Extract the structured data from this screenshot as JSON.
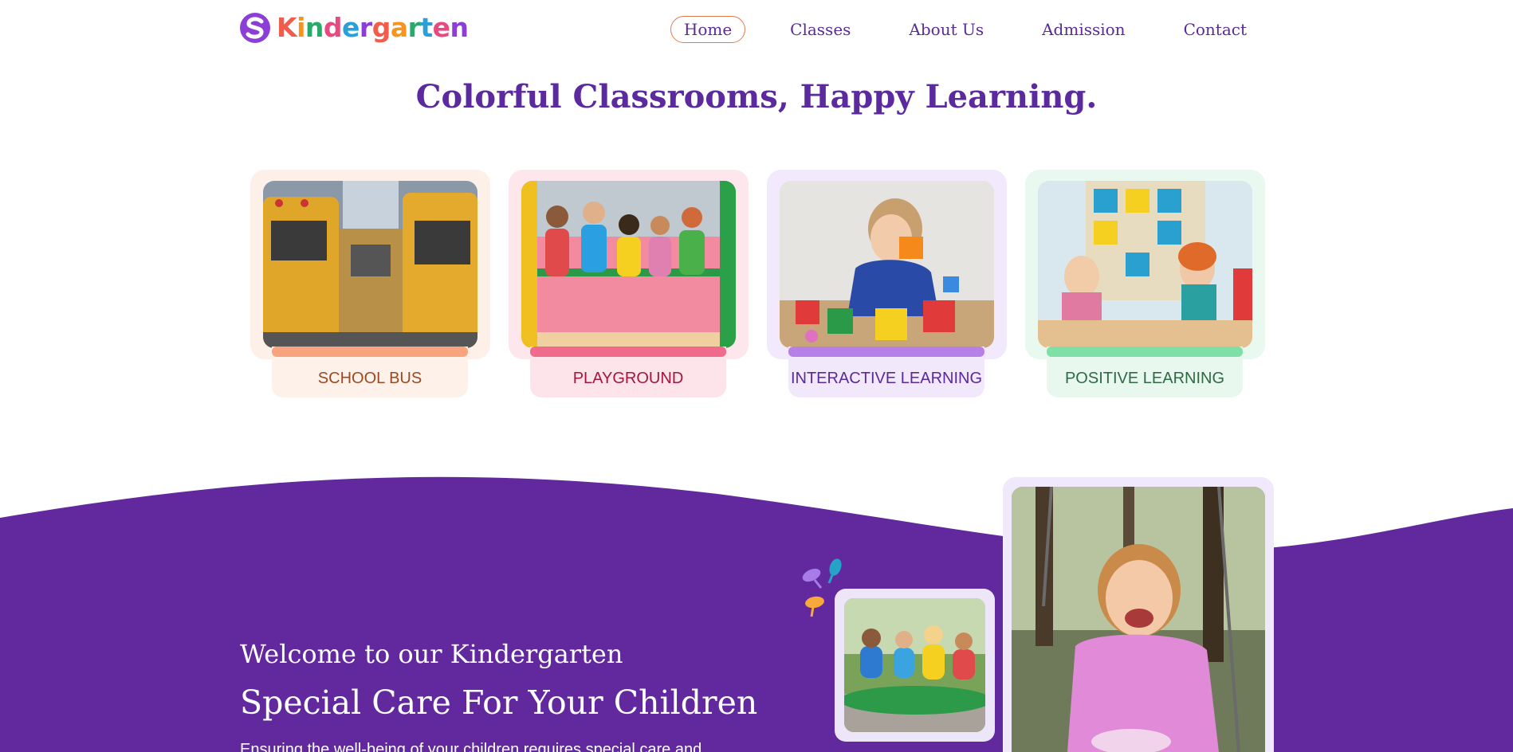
{
  "brand": {
    "name": "Kindergarten",
    "letters": [
      {
        "ch": "K",
        "color": "#f25c4c"
      },
      {
        "ch": "i",
        "color": "#f7941d"
      },
      {
        "ch": "n",
        "color": "#2aaa6a"
      },
      {
        "ch": "d",
        "color": "#e84a7f"
      },
      {
        "ch": "e",
        "color": "#2a9fd8"
      },
      {
        "ch": "r",
        "color": "#8b3fd6"
      },
      {
        "ch": "g",
        "color": "#f25c4c"
      },
      {
        "ch": "a",
        "color": "#f7941d"
      },
      {
        "ch": "r",
        "color": "#2aaa6a"
      },
      {
        "ch": "t",
        "color": "#2a9fd8"
      },
      {
        "ch": "e",
        "color": "#e84a7f"
      },
      {
        "ch": "n",
        "color": "#8b3fd6"
      }
    ],
    "logo_icon": "s-swirl-icon"
  },
  "nav": {
    "items": [
      {
        "label": "Home",
        "active": true
      },
      {
        "label": "Classes",
        "active": false
      },
      {
        "label": "About Us",
        "active": false
      },
      {
        "label": "Admission",
        "active": false
      },
      {
        "label": "Contact",
        "active": false
      }
    ]
  },
  "gallery": {
    "title": "Colorful Classrooms, Happy Learning.",
    "cards": [
      {
        "label": "SCHOOL BUS",
        "bg": "#fdf0e9",
        "bar": "#f7a47e",
        "label_bg": "#fef1ea",
        "label_color": "#9a4a22"
      },
      {
        "label": "PLAYGROUND",
        "bg": "#fde6ec",
        "bar": "#f06a8c",
        "label_bg": "#fde4ea",
        "label_color": "#a3163e"
      },
      {
        "label": "INTERACTIVE LEARNING",
        "bg": "#f3e9fc",
        "bar": "#b77fe8",
        "label_bg": "#f2e8fc",
        "label_color": "#5a2a9a"
      },
      {
        "label": "POSITIVE LEARNING",
        "bg": "#e9f9f0",
        "bar": "#7ee0a6",
        "label_bg": "#e8f8ee",
        "label_color": "#2f6a44"
      }
    ]
  },
  "welcome": {
    "subtitle": "Welcome to our Kindergarten",
    "title": "Special Care For Your Children",
    "text": "Ensuring the well-being of your children requires special care and",
    "wave_color": "#62299e"
  }
}
